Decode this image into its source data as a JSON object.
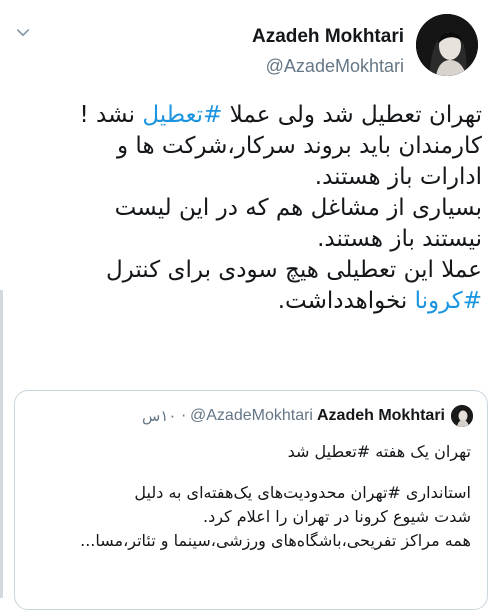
{
  "author": {
    "display_name": "Azadeh Mokhtari",
    "handle": "@AzadeMokhtari"
  },
  "tweet": {
    "line1_a": "تهران تعطیل شد ولی عملا ",
    "line1_tag": "#تعطیل",
    "line1_b": " نشد !",
    "line2": "کارمندان باید بروند سرکار،شرکت ها و",
    "line3": "ادارات باز هستند.",
    "line4": "بسیاری از مشاغل هم که در این لیست",
    "line5": "نیستند باز هستند.",
    "line6": "عملا این تعطیلی هیچ سودی برای کنترل",
    "line7_tag": "#کرونا",
    "line7_b": " نخواهدداشت."
  },
  "quoted": {
    "display_name": "Azadeh Mokhtari",
    "handle": "@AzadeMokhtari",
    "time": "· ۱۰س",
    "title": "تهران یک هفته #تعطیل شد",
    "body_line1": "استانداری #تهران محدودیت‌های یک‌هفته‌ای به دلیل",
    "body_line2": "شدت شیوع کرونا در تهران را اعلام کرد.",
    "body_line3": "همه مراکز تفریحی،باشگاه‌های ورزشی،سینما و تئاتر،مسا..."
  },
  "colors": {
    "link": "#1b95e0",
    "muted": "#657786",
    "border": "#ccd6dd"
  },
  "icons": {
    "menu": "chevron-down-icon"
  }
}
